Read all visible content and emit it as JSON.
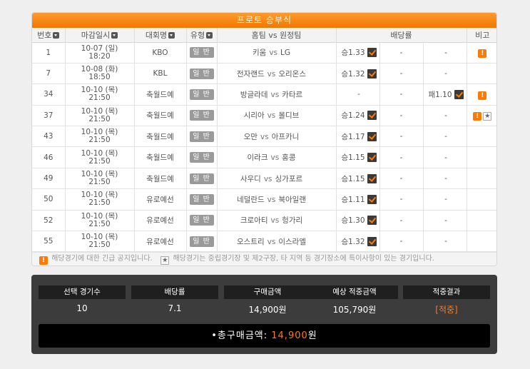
{
  "board": {
    "title": "프로토 승부식",
    "columns": [
      "번호",
      "마감일시",
      "대회명",
      "유형",
      "홈팀 vs 원정팀",
      "배당률",
      "비고"
    ],
    "games": [
      {
        "no": "1",
        "date": "10-07 (일)",
        "time": "18:20",
        "league": "KBO",
        "type": "일 반",
        "home": "키움",
        "vs": "vs",
        "away": "LG",
        "o1": "승1.33",
        "o2": "-",
        "o3": "-",
        "o1chk": true,
        "o3chk": false,
        "warn": true,
        "star": false
      },
      {
        "no": "7",
        "date": "10-08 (화)",
        "time": "18:50",
        "league": "KBL",
        "type": "일 반",
        "home": "전자랜드",
        "vs": "vs",
        "away": "오리온스",
        "o1": "승1.32",
        "o2": "-",
        "o3": "-",
        "o1chk": true,
        "o3chk": false,
        "warn": false,
        "star": false
      },
      {
        "no": "34",
        "date": "10-10 (목)",
        "time": "21:50",
        "league": "축월드예",
        "type": "일 반",
        "home": "방글라데",
        "vs": "vs",
        "away": "카타르",
        "o1": "-",
        "o2": "-",
        "o3": "패1.10",
        "o1chk": false,
        "o3chk": true,
        "warn": true,
        "star": false
      },
      {
        "no": "37",
        "date": "10-10 (목)",
        "time": "21:50",
        "league": "축월드예",
        "type": "일 반",
        "home": "시리아",
        "vs": "vs",
        "away": "몰디브",
        "o1": "승1.24",
        "o2": "-",
        "o3": "-",
        "o1chk": true,
        "o3chk": false,
        "warn": true,
        "star": true
      },
      {
        "no": "43",
        "date": "10-10 (목)",
        "time": "21:50",
        "league": "축월드예",
        "type": "일 반",
        "home": "오만",
        "vs": "vs",
        "away": "아프카니",
        "o1": "승1.17",
        "o2": "-",
        "o3": "-",
        "o1chk": true,
        "o3chk": false,
        "warn": false,
        "star": false
      },
      {
        "no": "46",
        "date": "10-10 (목)",
        "time": "21:50",
        "league": "축월드예",
        "type": "일 반",
        "home": "이라크",
        "vs": "vs",
        "away": "홍콩",
        "o1": "승1.15",
        "o2": "-",
        "o3": "-",
        "o1chk": true,
        "o3chk": false,
        "warn": false,
        "star": false
      },
      {
        "no": "49",
        "date": "10-10 (목)",
        "time": "21:50",
        "league": "축월드예",
        "type": "일 반",
        "home": "사우디",
        "vs": "vs",
        "away": "싱가포르",
        "o1": "승1.15",
        "o2": "-",
        "o3": "-",
        "o1chk": true,
        "o3chk": false,
        "warn": false,
        "star": false
      },
      {
        "no": "50",
        "date": "10-10 (목)",
        "time": "21:50",
        "league": "유로예선",
        "type": "일 반",
        "home": "네덜란드",
        "vs": "vs",
        "away": "북아일랜",
        "o1": "승1.11",
        "o2": "-",
        "o3": "-",
        "o1chk": true,
        "o3chk": false,
        "warn": false,
        "star": false
      },
      {
        "no": "52",
        "date": "10-10 (목)",
        "time": "21:50",
        "league": "유로예선",
        "type": "일 반",
        "home": "크로아티",
        "vs": "vs",
        "away": "헝가리",
        "o1": "승1.30",
        "o2": "-",
        "o3": "-",
        "o1chk": true,
        "o3chk": false,
        "warn": false,
        "star": false
      },
      {
        "no": "55",
        "date": "10-10 (목)",
        "time": "21:50",
        "league": "유로예선",
        "type": "일 반",
        "home": "오스트리",
        "vs": "vs",
        "away": "이스라엘",
        "o1": "승1.32",
        "o2": "-",
        "o3": "-",
        "o1chk": true,
        "o3chk": false,
        "warn": false,
        "star": false
      }
    ],
    "notice": {
      "warn_icon": "!",
      "warn_text": "해당경기에 대한 긴급 공지입니다.",
      "star_icon": "★",
      "star_text": "해당경기는 중립경기장 및 제2구장, 타 지역 등 경기장소에 특이사항이 있는 경기입니다."
    },
    "colors": {
      "accent": "#f07800",
      "check": "#3a3a3a"
    }
  },
  "summary": {
    "headers": [
      "선택 경기수",
      "배당률",
      "구매금액",
      "예상 적중금액",
      "적중결과"
    ],
    "values": [
      "10",
      "7.1",
      "14,900원",
      "105,790원",
      "[적중]"
    ],
    "total_label": "•총구매금액:",
    "total_amount": "14,900",
    "total_unit": "원"
  }
}
